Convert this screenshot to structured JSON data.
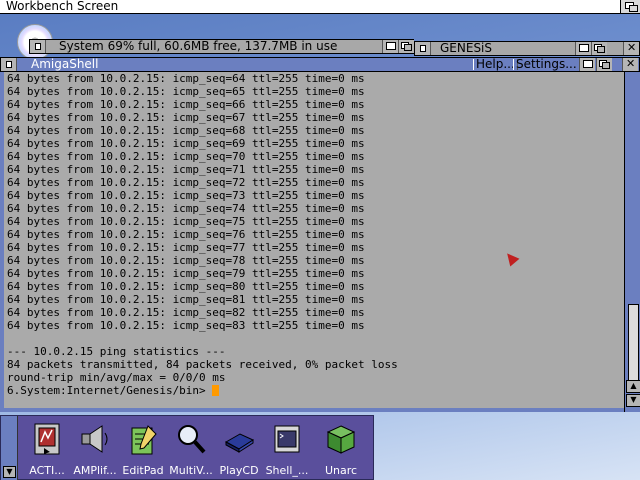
{
  "screen": {
    "title": "Workbench Screen"
  },
  "system_window": {
    "title": "System  69% full, 60.6MB free, 137.7MB in use"
  },
  "genesis_window": {
    "title": "GENESiS",
    "help_label": "Help...",
    "settings_label": "Settings..."
  },
  "shell": {
    "title": "AmigaShell",
    "lines": [
      "64 bytes from 10.0.2.15: icmp_seq=64 ttl=255 time=0 ms",
      "64 bytes from 10.0.2.15: icmp_seq=65 ttl=255 time=0 ms",
      "64 bytes from 10.0.2.15: icmp_seq=66 ttl=255 time=0 ms",
      "64 bytes from 10.0.2.15: icmp_seq=67 ttl=255 time=0 ms",
      "64 bytes from 10.0.2.15: icmp_seq=68 ttl=255 time=0 ms",
      "64 bytes from 10.0.2.15: icmp_seq=69 ttl=255 time=0 ms",
      "64 bytes from 10.0.2.15: icmp_seq=70 ttl=255 time=0 ms",
      "64 bytes from 10.0.2.15: icmp_seq=71 ttl=255 time=0 ms",
      "64 bytes from 10.0.2.15: icmp_seq=72 ttl=255 time=0 ms",
      "64 bytes from 10.0.2.15: icmp_seq=73 ttl=255 time=0 ms",
      "64 bytes from 10.0.2.15: icmp_seq=74 ttl=255 time=0 ms",
      "64 bytes from 10.0.2.15: icmp_seq=75 ttl=255 time=0 ms",
      "64 bytes from 10.0.2.15: icmp_seq=76 ttl=255 time=0 ms",
      "64 bytes from 10.0.2.15: icmp_seq=77 ttl=255 time=0 ms",
      "64 bytes from 10.0.2.15: icmp_seq=78 ttl=255 time=0 ms",
      "64 bytes from 10.0.2.15: icmp_seq=79 ttl=255 time=0 ms",
      "64 bytes from 10.0.2.15: icmp_seq=80 ttl=255 time=0 ms",
      "64 bytes from 10.0.2.15: icmp_seq=81 ttl=255 time=0 ms",
      "64 bytes from 10.0.2.15: icmp_seq=82 ttl=255 time=0 ms",
      "64 bytes from 10.0.2.15: icmp_seq=83 ttl=255 time=0 ms",
      "",
      "--- 10.0.2.15 ping statistics ---",
      "84 packets transmitted, 84 packets received, 0% packet loss",
      "round-trip min/avg/max = 0/0/0 ms"
    ],
    "prompt": "6.System:Internet/Genesis/bin> "
  },
  "dock": {
    "items": [
      {
        "label": "ACTI...",
        "icon": "activity-icon"
      },
      {
        "label": "AMPlif...",
        "icon": "speaker-icon"
      },
      {
        "label": "EditPad",
        "icon": "notepad-icon"
      },
      {
        "label": "MultiV...",
        "icon": "magnifier-icon"
      },
      {
        "label": "PlayCD",
        "icon": "cd-player-icon"
      },
      {
        "label": "Shell_...",
        "icon": "shell-icon"
      },
      {
        "label": "Unarc",
        "icon": "archive-cube-icon"
      }
    ]
  },
  "colors": {
    "window_active": "#6b7fc0",
    "shell_bg": "#aaaaaa",
    "dock_bg": "#5a4f9c",
    "cursor": "#ff9a00"
  }
}
